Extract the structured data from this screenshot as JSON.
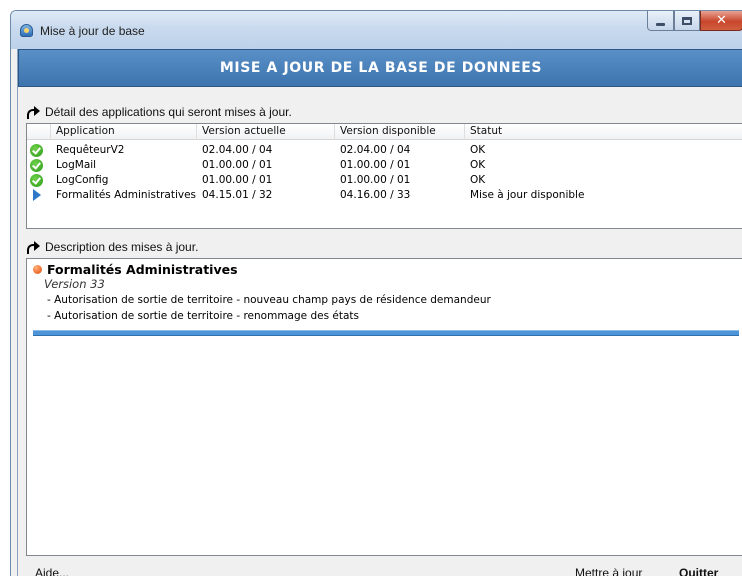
{
  "window": {
    "title": "Mise à jour de base"
  },
  "banner": {
    "title": "MISE A JOUR DE LA BASE DE DONNEES"
  },
  "applications_section": {
    "header": "Détail des applications qui seront mises à jour.",
    "columns": [
      "Application",
      "Version actuelle",
      "Version disponible",
      "Statut"
    ],
    "rows": [
      {
        "icon": "check-icon",
        "application": "RequêteurV2",
        "version_actuelle": "02.04.00 / 04",
        "version_disponible": "02.04.00 / 04",
        "statut": "OK"
      },
      {
        "icon": "check-icon",
        "application": "LogMail",
        "version_actuelle": "01.00.00 / 01",
        "version_disponible": "01.00.00 / 01",
        "statut": "OK"
      },
      {
        "icon": "check-icon",
        "application": "LogConfig",
        "version_actuelle": "01.00.00 / 01",
        "version_disponible": "01.00.00 / 01",
        "statut": "OK"
      },
      {
        "icon": "play-icon",
        "application": "Formalités Administratives",
        "version_actuelle": "04.15.01 / 32",
        "version_disponible": "04.16.00 / 33",
        "statut": "Mise à jour disponible"
      }
    ]
  },
  "description_section": {
    "header": "Description des mises à jour.",
    "item_title": "Formalités Administratives",
    "version": "Version 33",
    "lines": [
      "- Autorisation de sortie de territoire - nouveau champ pays de résidence demandeur",
      "- Autorisation de sortie de territoire - renommage des états"
    ]
  },
  "footer": {
    "help_label": "Aide...",
    "update_label_mnemonic": "M",
    "update_label_rest": "ettre à jour",
    "quit_label_mnemonic": "Q",
    "quit_label_rest": "uitter"
  }
}
